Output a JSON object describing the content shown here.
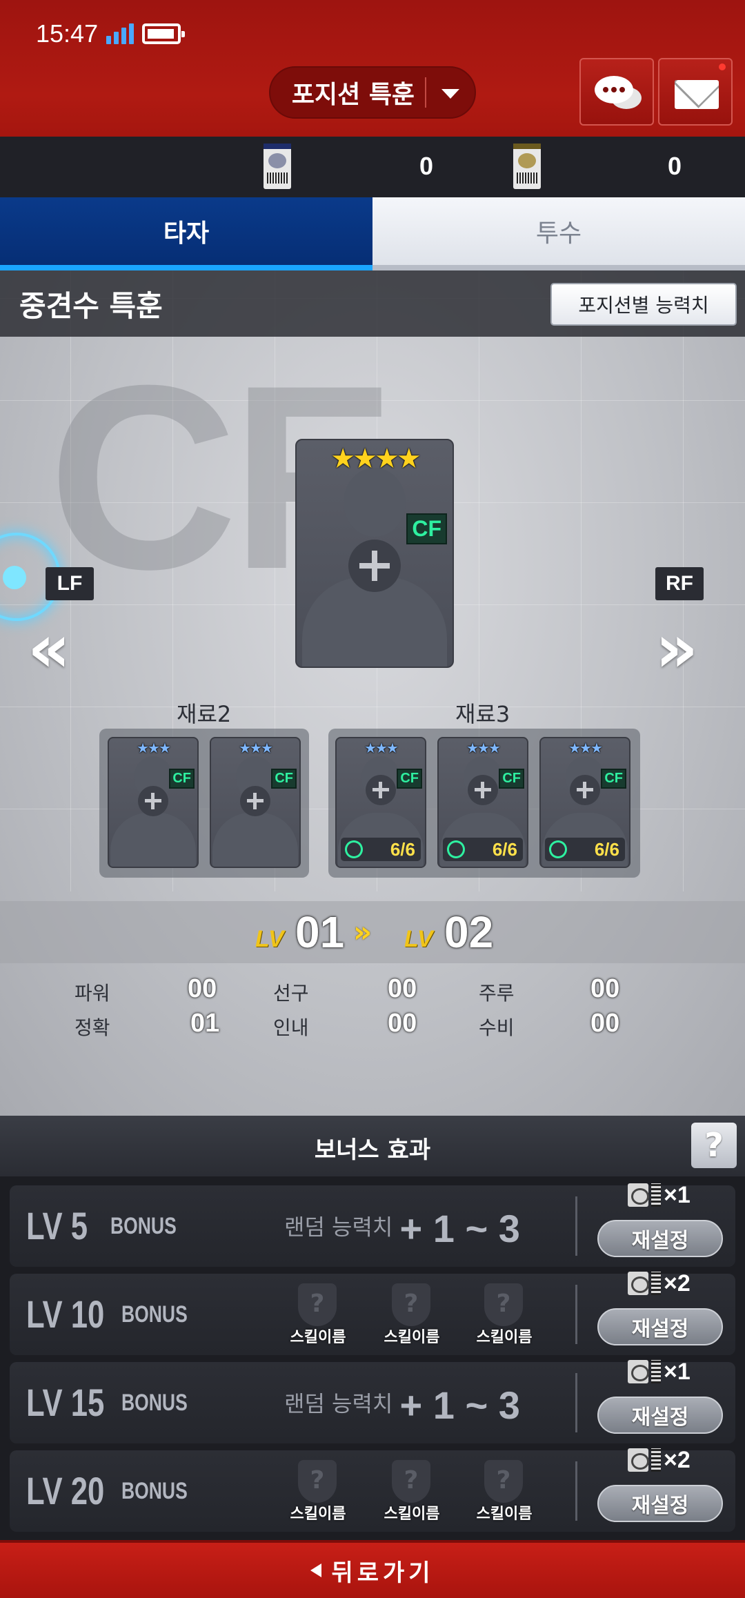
{
  "status": {
    "time": "15:47"
  },
  "header": {
    "mode_label": "포지션 특훈"
  },
  "tickets": [
    {
      "count": "0"
    },
    {
      "count": "0"
    }
  ],
  "tabs": {
    "batter": "타자",
    "pitcher": "투수"
  },
  "section": {
    "title": "중견수 특훈",
    "stats_button": "포지션별 능력치"
  },
  "position": {
    "background_label": "CF",
    "left": "LF",
    "right": "RF"
  },
  "main_card": {
    "stars": "★★★★",
    "position": "CF"
  },
  "materials": {
    "group2_label": "재료2",
    "group3_label": "재료3",
    "card_stars": "★★★",
    "card_position": "CF",
    "counter": "6/6"
  },
  "level": {
    "tag": "LV",
    "from": "01",
    "arrow": "»",
    "to": "02"
  },
  "stats": {
    "power": {
      "label": "파워",
      "value": "00"
    },
    "accuracy": {
      "label": "정확",
      "value": "01"
    },
    "eye": {
      "label": "선구",
      "value": "00"
    },
    "patience": {
      "label": "인내",
      "value": "00"
    },
    "running": {
      "label": "주루",
      "value": "00"
    },
    "defense": {
      "label": "수비",
      "value": "00"
    }
  },
  "bonus": {
    "title": "보너스 효과",
    "help": "?",
    "rows": [
      {
        "level": "LV 5",
        "word": "BONUS",
        "desc": "랜덤 능력치",
        "range": "+ 1 ~ 3",
        "cost": "×1",
        "button": "재설정"
      },
      {
        "level": "LV 10",
        "word": "BONUS",
        "skills": [
          "스킬이름",
          "스킬이름",
          "스킬이름"
        ],
        "cost": "×2",
        "button": "재설정"
      },
      {
        "level": "LV 15",
        "word": "BONUS",
        "desc": "랜덤 능력치",
        "range": "+ 1 ~ 3",
        "cost": "×1",
        "button": "재설정"
      },
      {
        "level": "LV 20",
        "word": "BONUS",
        "skills": [
          "스킬이름",
          "스킬이름",
          "스킬이름"
        ],
        "cost": "×2",
        "button": "재설정"
      }
    ]
  },
  "footer": {
    "back_label": "뒤로가기"
  },
  "colors": {
    "header_red": "#b01a12",
    "tab_active": "#0a3a8a",
    "accent_blue": "#1aa6ff",
    "badge_green": "#2ef0a0",
    "level_gold": "#f0c419"
  }
}
